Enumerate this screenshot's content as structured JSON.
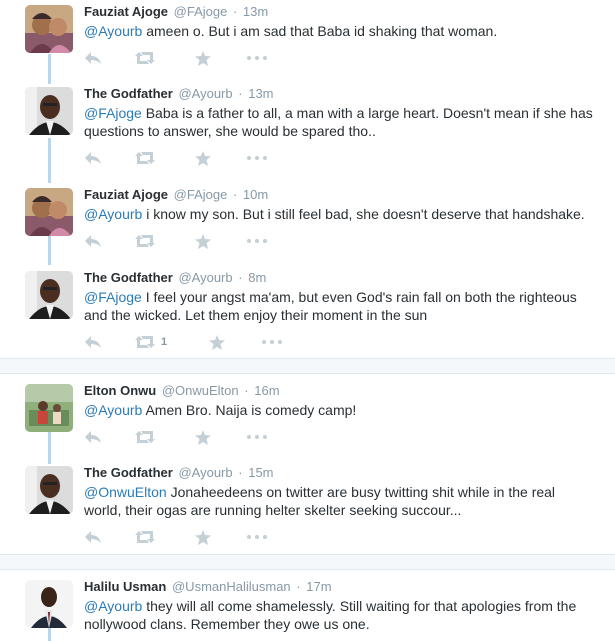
{
  "tweets": [
    {
      "fullname": "Fauziat Ajoge",
      "username": "@FAjoge",
      "time": "13m",
      "mention": "@Ayourb",
      "body": " ameen o. But i am sad that Baba id shaking that woman.",
      "retweets": ""
    },
    {
      "fullname": "The Godfather",
      "username": "@Ayourb",
      "time": "13m",
      "mention": "@FAjoge",
      "body": " Baba is a father to all, a man with a large heart. Doesn't mean if she has questions to answer, she would be spared tho..",
      "retweets": ""
    },
    {
      "fullname": "Fauziat Ajoge",
      "username": "@FAjoge",
      "time": "10m",
      "mention": "@Ayourb",
      "body": " i know my son. But i still feel bad, she doesn't deserve that handshake.",
      "retweets": ""
    },
    {
      "fullname": "The Godfather",
      "username": "@Ayourb",
      "time": "8m",
      "mention": "@FAjoge",
      "body": " I feel your angst ma'am, but even God's rain fall on both the righteous and the wicked. Let them enjoy their moment in the sun",
      "retweets": "1"
    },
    {
      "fullname": "Elton Onwu",
      "username": "@OnwuElton",
      "time": "16m",
      "mention": "@Ayourb",
      "body": " Amen Bro. Naija is comedy camp!",
      "retweets": ""
    },
    {
      "fullname": "The Godfather",
      "username": "@Ayourb",
      "time": "15m",
      "mention": "@OnwuElton",
      "body": " Jonaheedeens on twitter are busy twitting shit while in the real world, their ogas are running helter skelter seeking succour...",
      "retweets": ""
    },
    {
      "fullname": "Halilu Usman",
      "username": "@UsmanHalilusman",
      "time": "17m",
      "mention": "@Ayourb",
      "body": " they will all come shamelessly. Still waiting for that apologies from the nollywood clans. Remember they owe us one.",
      "retweets": ""
    }
  ],
  "separator": "·",
  "icons": {
    "reply": "reply-icon",
    "retweet": "retweet-icon",
    "favorite": "star-icon",
    "more": "more-icon"
  },
  "colors": {
    "name": "#292f33",
    "meta": "#8899a6",
    "link": "#2b7bb9",
    "icon": "#aab8c2",
    "thread": "#b9d6ec"
  }
}
